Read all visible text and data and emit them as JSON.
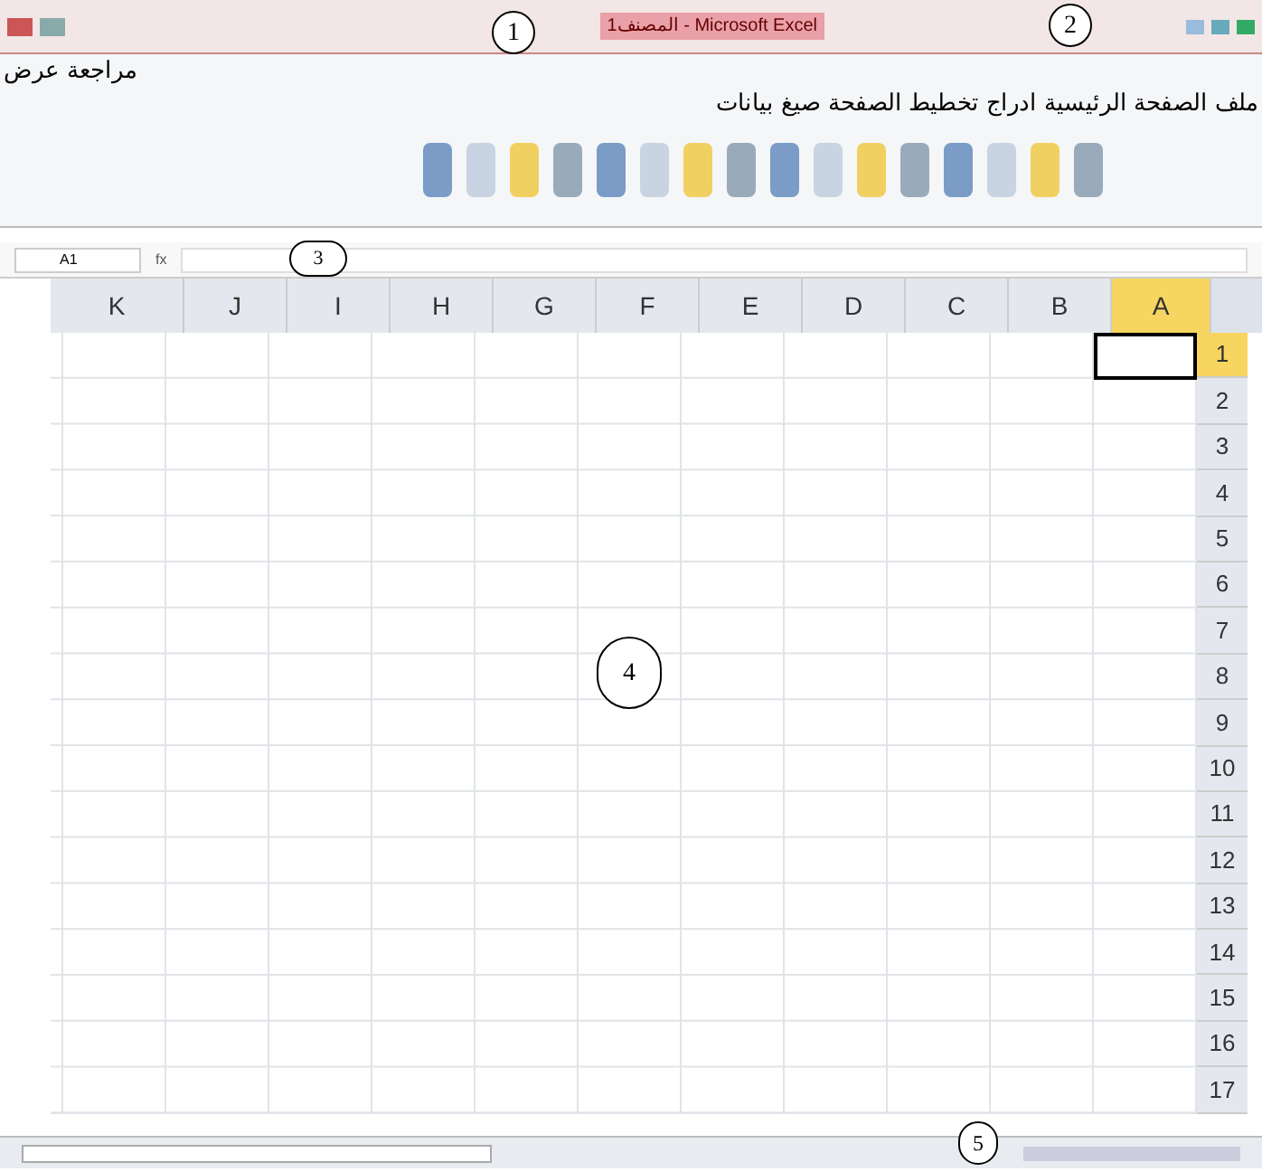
{
  "window": {
    "title": "المصنف1 - Microsoft Excel"
  },
  "tabs_overflow": [
    {
      "label": "مراجعة"
    },
    {
      "label": "عرض"
    }
  ],
  "tabs": [
    {
      "label": "ملف"
    },
    {
      "label": "الصفحة الرئيسية"
    },
    {
      "label": "ادراج"
    },
    {
      "label": "تخطيط الصفحة"
    },
    {
      "label": "صيغ"
    },
    {
      "label": "بيانات"
    }
  ],
  "formula_bar": {
    "name_box": "A1",
    "fx": "fx"
  },
  "columns": [
    {
      "label": "A",
      "selected": true
    },
    {
      "label": "B",
      "selected": false
    },
    {
      "label": "C",
      "selected": false
    },
    {
      "label": "D",
      "selected": false
    },
    {
      "label": "E",
      "selected": false
    },
    {
      "label": "F",
      "selected": false
    },
    {
      "label": "G",
      "selected": false
    },
    {
      "label": "H",
      "selected": false
    },
    {
      "label": "I",
      "selected": false
    },
    {
      "label": "J",
      "selected": false
    },
    {
      "label": "K",
      "selected": false
    }
  ],
  "rows": [
    {
      "label": "1",
      "selected": true
    },
    {
      "label": "2",
      "selected": false
    },
    {
      "label": "3",
      "selected": false
    },
    {
      "label": "4",
      "selected": false
    },
    {
      "label": "5",
      "selected": false
    },
    {
      "label": "6",
      "selected": false
    },
    {
      "label": "7",
      "selected": false
    },
    {
      "label": "8",
      "selected": false
    },
    {
      "label": "9",
      "selected": false
    },
    {
      "label": "10",
      "selected": false
    },
    {
      "label": "11",
      "selected": false
    },
    {
      "label": "12",
      "selected": false
    },
    {
      "label": "13",
      "selected": false
    },
    {
      "label": "14",
      "selected": false
    },
    {
      "label": "15",
      "selected": false
    },
    {
      "label": "16",
      "selected": false
    },
    {
      "label": "17",
      "selected": false
    }
  ],
  "callouts": [
    {
      "label": "1"
    },
    {
      "label": "2"
    },
    {
      "label": "3"
    },
    {
      "label": "4"
    },
    {
      "label": "5"
    }
  ]
}
